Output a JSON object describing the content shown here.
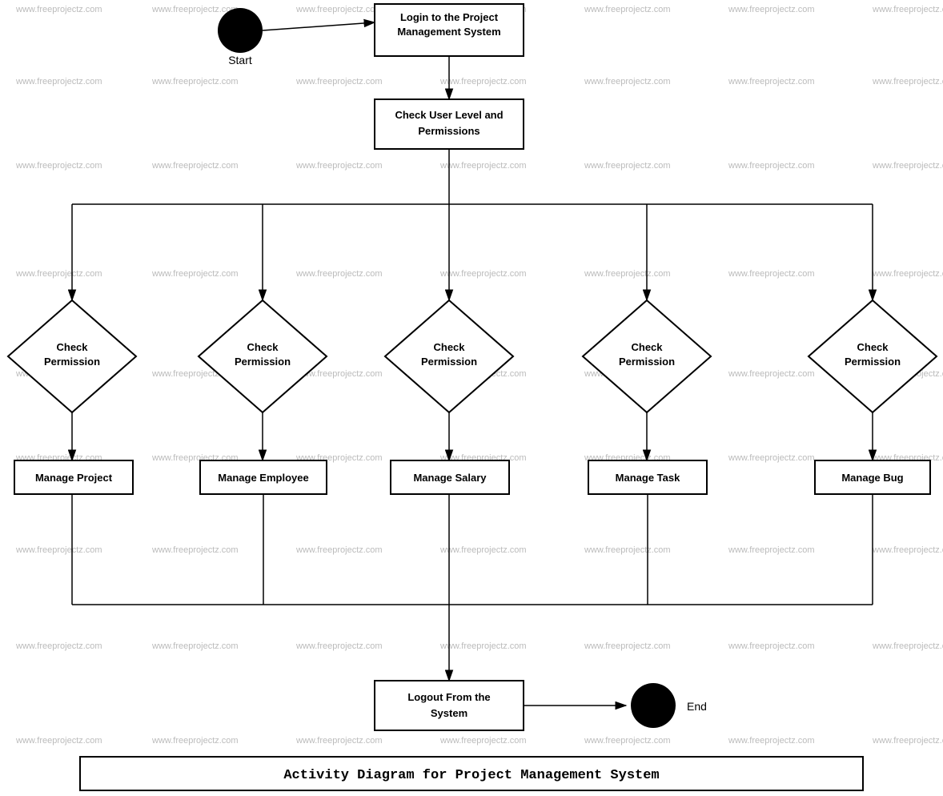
{
  "diagram": {
    "title": "Activity Diagram for Project Management System",
    "watermark": "www.freeprojectz.com",
    "nodes": {
      "start": {
        "label": "Start"
      },
      "login": {
        "label": "Login to the Project Management System"
      },
      "check_user_level": {
        "label": "Check User Level and Permissions"
      },
      "check_permission_1": {
        "label": "Check Permission"
      },
      "check_permission_2": {
        "label": "Check Permission"
      },
      "check_permission_3": {
        "label": "Check Permission"
      },
      "check_permission_4": {
        "label": "Check Permission"
      },
      "check_permission_5": {
        "label": "Check Permission"
      },
      "manage_project": {
        "label": "Manage Project"
      },
      "manage_employee": {
        "label": "Manage Employee"
      },
      "manage_salary": {
        "label": "Manage Salary"
      },
      "manage_task": {
        "label": "Manage Task"
      },
      "manage_bug": {
        "label": "Manage Bug"
      },
      "logout": {
        "label": "Logout From the System"
      },
      "end": {
        "label": "End"
      }
    }
  }
}
